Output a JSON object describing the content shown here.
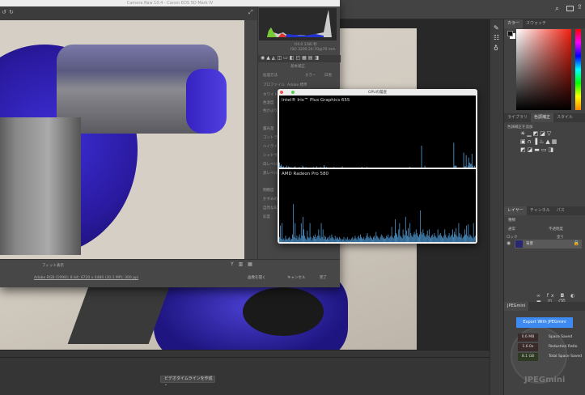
{
  "camera_raw": {
    "title": "Camera Raw 10.4 - Canon EOS 5D Mark IV",
    "panel_title": "基本補正",
    "histogram_readout": [
      "f/4.0  1/80 秒",
      "ISO 3200  24-70@70 mm"
    ],
    "settings": [
      "処理方法",
      "カラー",
      "白黒",
      "プロファイル",
      "Adobe 標準",
      "ホワイトバランス",
      "色温度",
      "色かぶり補正",
      "露光量",
      "コントラスト",
      "ハイライト",
      "シャドウ",
      "白レベル",
      "黒レベル",
      "明瞭度",
      "かすみの除去",
      "自然な彩度",
      "彩度"
    ],
    "zoom_label": "フィット表示",
    "file_info": "Adobe RGB (1998); 8 bit; 6720 x 4480 (30.1 MP); 300 ppi",
    "buttons": {
      "open": "画像を開く",
      "cancel": "キャンセル",
      "done": "完了"
    }
  },
  "gpu_window": {
    "title": "GPUの履歴",
    "gpus": [
      {
        "name": "Intel® Iris™ Plus Graphics 655",
        "color": "#5a9fd4",
        "bars": [
          8,
          3,
          5,
          2,
          1,
          2,
          0,
          1,
          0,
          3,
          0,
          2,
          1,
          0,
          1,
          0,
          0,
          0,
          1,
          2,
          0,
          0,
          0,
          0,
          1,
          0,
          0,
          0,
          3,
          1,
          0,
          0,
          1,
          0,
          0,
          0,
          0,
          0,
          0,
          0,
          0,
          1,
          0,
          0,
          0,
          2,
          0,
          0,
          0,
          0,
          1,
          0,
          0,
          0,
          4,
          1,
          0,
          1,
          0,
          0,
          0,
          0,
          0,
          0,
          0,
          0,
          1,
          0,
          0,
          0,
          0,
          0,
          0,
          0,
          0,
          0,
          2,
          0,
          0,
          0,
          0,
          0,
          0,
          0,
          0,
          0,
          0,
          0,
          0,
          0,
          0,
          0,
          0,
          0,
          0,
          0,
          0,
          0,
          0,
          0,
          1,
          0,
          0,
          0,
          0,
          0,
          1,
          0,
          0,
          0,
          0,
          0,
          0,
          0,
          0,
          0,
          0,
          0,
          0,
          0,
          0,
          0,
          0,
          0,
          0,
          0,
          0,
          0,
          0,
          0,
          0,
          0,
          0,
          0,
          0,
          0,
          0,
          0,
          0,
          0,
          0,
          0,
          0,
          0,
          0,
          0,
          0,
          0,
          0,
          0,
          0,
          0,
          0,
          0,
          0,
          0,
          0,
          0,
          1,
          0,
          0,
          0,
          0,
          0,
          0,
          0,
          0,
          0,
          0,
          0,
          0,
          0,
          35,
          0,
          0,
          0,
          3,
          0,
          0,
          0,
          0,
          0,
          0,
          0,
          0,
          0,
          0,
          0,
          0,
          0,
          0,
          0,
          0,
          0,
          0,
          0,
          0,
          0,
          0,
          0,
          0,
          0,
          0,
          0,
          0,
          0,
          0,
          0,
          0,
          0,
          0,
          40,
          3,
          3,
          3,
          0,
          0,
          0,
          0,
          0,
          0,
          0,
          0,
          24,
          2,
          2,
          20,
          0,
          3,
          16,
          8,
          6,
          6,
          22,
          3,
          0,
          3,
          0
        ]
      },
      {
        "name": "AMD Radeon Pro 580",
        "color": "#4a8fc4",
        "bars": [
          8,
          26,
          5,
          30,
          4,
          6,
          3,
          10,
          5,
          4,
          6,
          8,
          6,
          3,
          5,
          12,
          60,
          8,
          30,
          6,
          10,
          4,
          8,
          12,
          6,
          30,
          10,
          40,
          20,
          10,
          6,
          4,
          18,
          8,
          6,
          30,
          8,
          3,
          6,
          10,
          8,
          12,
          5,
          8,
          10,
          20,
          10,
          6,
          30,
          8,
          20,
          5,
          10,
          8,
          4,
          6,
          8,
          4,
          10,
          6,
          12,
          8,
          6,
          4,
          10,
          5,
          8,
          6,
          4,
          8,
          6,
          3,
          5,
          4,
          8,
          2,
          6,
          4,
          8,
          3,
          5,
          2,
          4,
          6,
          8,
          4,
          6,
          10,
          6,
          4,
          8,
          10,
          6,
          12,
          8,
          6,
          5,
          8,
          4,
          6,
          10,
          14,
          8,
          6,
          10,
          8,
          6,
          4,
          8,
          10,
          6,
          16,
          10,
          8,
          6,
          4,
          8,
          12,
          10,
          6,
          8,
          5,
          6,
          10,
          8,
          12,
          6,
          8,
          10,
          24,
          8,
          6,
          10,
          36,
          14,
          12,
          8,
          20,
          30,
          10,
          8,
          6,
          20,
          12,
          10,
          40,
          18,
          10,
          22,
          8,
          30,
          14,
          10,
          8,
          12,
          16,
          12,
          20,
          14,
          10,
          8,
          12,
          50,
          16,
          12,
          20,
          14,
          10,
          8,
          12,
          18,
          10,
          20,
          8,
          6,
          10,
          12,
          8,
          14,
          10,
          8,
          6,
          20,
          10,
          12,
          14,
          10,
          8,
          6,
          10,
          20,
          12,
          8,
          6,
          10,
          14,
          8,
          10,
          12,
          20,
          8,
          16,
          12,
          22,
          10,
          8,
          30,
          14,
          8,
          12,
          6,
          8,
          10,
          20,
          12,
          26,
          10,
          28,
          8,
          12,
          10,
          8,
          6,
          30,
          8,
          10
        ]
      }
    ]
  },
  "photoshop": {
    "timeline_button": "ビデオタイムラインを作成",
    "color_tabs": [
      "カラー",
      "スウォッチ"
    ],
    "adjust_tabs": [
      "ライブラリ",
      "色調補正",
      "スタイル"
    ],
    "adjust_label": "色調補正を追加",
    "layer_tabs": [
      "レイヤー",
      "チャンネル",
      "パス"
    ],
    "layer_filter": "種類",
    "blend_mode": "通常",
    "opacity_label": "不透明度",
    "lock_label": "ロック",
    "fill_label": "塗り",
    "layer_name": "背景",
    "jpegmini": {
      "tab": "JPEGmini",
      "export_button": "Export With JPEGmini",
      "stats": [
        {
          "value": "0.6 MB",
          "label": "Space Saved"
        },
        {
          "value": "1.6.0x",
          "label": "Reduction Ratio"
        },
        {
          "value": "8.1 GB",
          "label": "Total Space Saved"
        }
      ],
      "logo": "JPEGmini"
    }
  }
}
